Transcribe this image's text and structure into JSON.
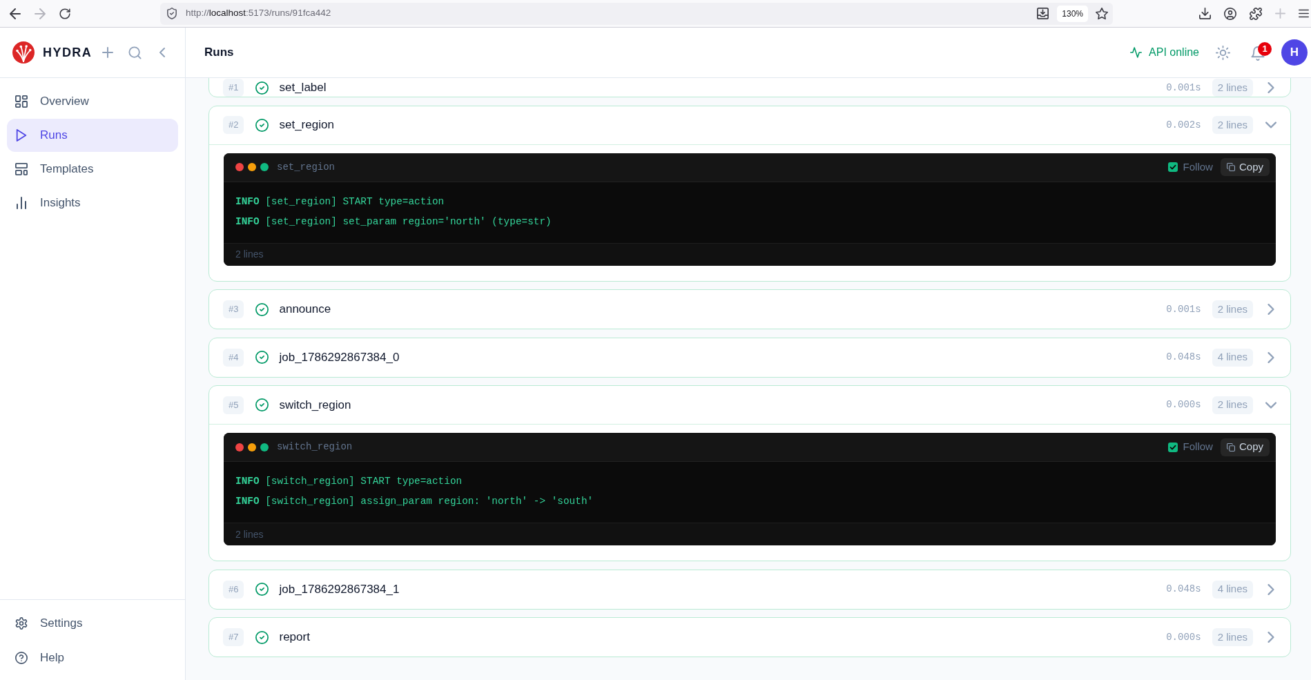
{
  "browser": {
    "nav_buttons": [
      {
        "kind": "back",
        "disabled": false
      },
      {
        "kind": "forward",
        "disabled": true
      },
      {
        "kind": "reload",
        "disabled": false
      }
    ],
    "url": {
      "scheme": "http://",
      "host": "localhost",
      "path": ":5173/runs/91fca442"
    },
    "zoom": "130%"
  },
  "sidebar": {
    "brand": "HYDRA",
    "nav": [
      {
        "label": "Overview",
        "kind": "dashboard",
        "selected": false
      },
      {
        "label": "Runs",
        "kind": "play",
        "selected": true
      },
      {
        "label": "Templates",
        "kind": "layout",
        "selected": false
      },
      {
        "label": "Insights",
        "kind": "chart",
        "selected": false
      }
    ],
    "footer": [
      {
        "label": "Settings",
        "kind": "gear"
      },
      {
        "label": "Help",
        "kind": "help"
      }
    ]
  },
  "header": {
    "title": "Runs",
    "api_status": "API online",
    "notification_count": "1",
    "avatar": "H"
  },
  "steps": [
    {
      "number": "#1",
      "name": "set_label",
      "duration": "0.001s",
      "lines": "2 lines",
      "expanded": false
    },
    {
      "number": "#2",
      "name": "set_region",
      "duration": "0.002s",
      "lines": "2 lines",
      "expanded": true,
      "log": {
        "title": "set_region",
        "follow": true,
        "follow_label": "Follow",
        "copy_label": "Copy",
        "lines": [
          "**INFO** [set_region] START type=action",
          "**INFO** [set_region] set_param region='north' (type=str)"
        ],
        "footer": "2 lines"
      }
    },
    {
      "number": "#3",
      "name": "announce",
      "duration": "0.001s",
      "lines": "2 lines",
      "expanded": false
    },
    {
      "number": "#4",
      "name": "job_1786292867384_0",
      "duration": "0.048s",
      "lines": "4 lines",
      "expanded": false
    },
    {
      "number": "#5",
      "name": "switch_region",
      "duration": "0.000s",
      "lines": "2 lines",
      "expanded": true,
      "log": {
        "title": "switch_region",
        "follow": true,
        "follow_label": "Follow",
        "copy_label": "Copy",
        "lines": [
          "**INFO** [switch_region] START type=action",
          "**INFO** [switch_region] assign_param region: 'north' -> 'south'"
        ],
        "footer": "2 lines"
      }
    },
    {
      "number": "#6",
      "name": "job_1786292867384_1",
      "duration": "0.048s",
      "lines": "4 lines",
      "expanded": false
    },
    {
      "number": "#7",
      "name": "report",
      "duration": "0.000s",
      "lines": "2 lines",
      "expanded": false
    }
  ]
}
